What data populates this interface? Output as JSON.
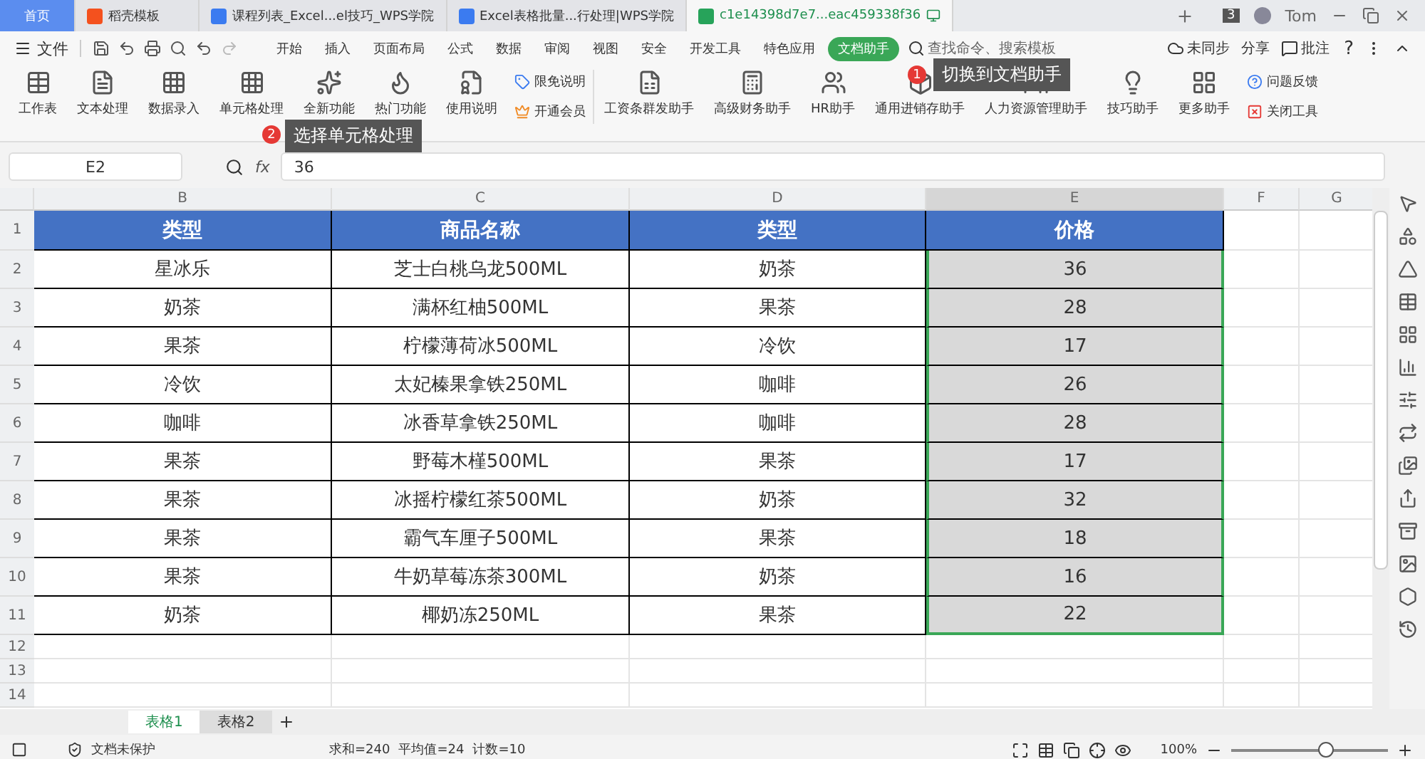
{
  "tabs": [
    {
      "label": "首页",
      "kind": "home",
      "selected": false
    },
    {
      "label": "稻壳模板",
      "kind": "docer",
      "selected": false
    },
    {
      "label": "课程列表_Excel...el技巧_WPS学院",
      "kind": "web",
      "selected": false
    },
    {
      "label": "Excel表格批量...行处理|WPS学院",
      "kind": "web",
      "selected": false
    },
    {
      "label": "c1e14398d7e7...eac459338f36",
      "kind": "sheet",
      "selected": true
    }
  ],
  "window_count": "3",
  "user": "Tom",
  "menu": {
    "file": "文件",
    "items": [
      {
        "label": "开始",
        "selected": false
      },
      {
        "label": "插入",
        "selected": false
      },
      {
        "label": "页面布局",
        "selected": false
      },
      {
        "label": "公式",
        "selected": false
      },
      {
        "label": "数据",
        "selected": false
      },
      {
        "label": "审阅",
        "selected": false
      },
      {
        "label": "视图",
        "selected": false
      },
      {
        "label": "安全",
        "selected": false
      },
      {
        "label": "开发工具",
        "selected": false
      },
      {
        "label": "特色应用",
        "selected": false
      },
      {
        "label": "文档助手",
        "selected": true
      }
    ],
    "search": {
      "placeholder": "查找命令、搜索模板"
    },
    "sync": "未同步",
    "share": "分享",
    "comment": "批注",
    "help": "?"
  },
  "ribbon": {
    "tools": [
      {
        "label": "工作表",
        "kind": "sheet"
      },
      {
        "label": "文本处理",
        "kind": "text"
      },
      {
        "label": "数据录入",
        "kind": "input"
      },
      {
        "label": "单元格处理",
        "kind": "cell"
      },
      {
        "label": "全新功能",
        "kind": "new"
      },
      {
        "label": "热门功能",
        "kind": "hot"
      }
    ],
    "guide": "使用说明",
    "links": [
      "限免说明",
      "开通会员"
    ],
    "assistants": [
      "工资条群发助手",
      "高级财务助手",
      "HR助手",
      "通用进销存助手",
      "人力资源管理助手",
      "技巧助手",
      "更多助手"
    ],
    "side_links": [
      "问题反馈",
      "关闭工具"
    ]
  },
  "callouts": [
    {
      "number": "1",
      "text": "切换到文档助手"
    },
    {
      "number": "2",
      "text": "选择单元格处理"
    }
  ],
  "formula_bar": {
    "cell": "E2",
    "fx_label": "fx",
    "value": "36"
  },
  "columns": [
    {
      "label": "B",
      "selected": false
    },
    {
      "label": "C",
      "selected": false
    },
    {
      "label": "D",
      "selected": false
    },
    {
      "label": "E",
      "selected": true
    },
    {
      "label": "F",
      "selected": false
    },
    {
      "label": "G",
      "selected": false
    }
  ],
  "table": {
    "header": [
      "类型",
      "商品名称",
      "类型",
      "价格"
    ],
    "rows": [
      [
        "星冰乐",
        "芝士白桃乌龙500ML",
        "奶茶",
        "36"
      ],
      [
        "奶茶",
        "满杯红柚500ML",
        "果茶",
        "28"
      ],
      [
        "果茶",
        "柠檬薄荷冰500ML",
        "冷饮",
        "17"
      ],
      [
        "冷饮",
        "太妃榛果拿铁250ML",
        "咖啡",
        "26"
      ],
      [
        "咖啡",
        "冰香草拿铁250ML",
        "咖啡",
        "28"
      ],
      [
        "果茶",
        "野莓木槿500ML",
        "果茶",
        "17"
      ],
      [
        "果茶",
        "冰摇柠檬红茶500ML",
        "奶茶",
        "32"
      ],
      [
        "果茶",
        "霸气车厘子500ML",
        "果茶",
        "18"
      ],
      [
        "果茶",
        "牛奶草莓冻茶300ML",
        "奶茶",
        "16"
      ],
      [
        "奶茶",
        "椰奶冻250ML",
        "果茶",
        "22"
      ]
    ]
  },
  "row_numbers": [
    "1",
    "2",
    "3",
    "4",
    "5",
    "6",
    "7",
    "8",
    "9",
    "10",
    "11",
    "12",
    "13",
    "14"
  ],
  "sheets": [
    {
      "label": "表格1",
      "selected": true
    },
    {
      "label": "表格2",
      "selected": false
    }
  ],
  "status": {
    "protection": "文档未保护",
    "sum": "求和=240",
    "average": "平均值=24",
    "count": "计数=10",
    "zoom": "100%",
    "level": 0.6
  }
}
